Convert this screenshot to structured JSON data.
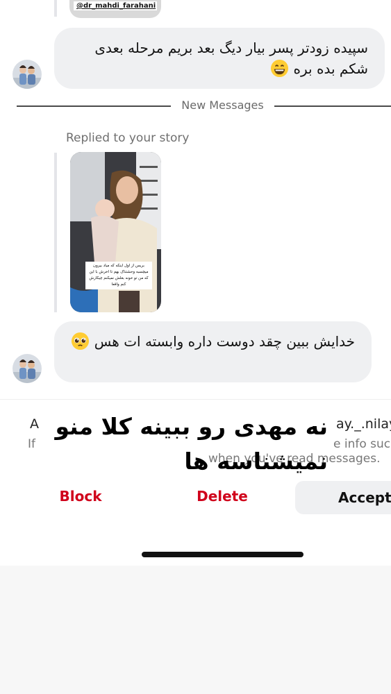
{
  "top_story": {
    "username": "@dr_mahdi_farahani"
  },
  "messages": [
    {
      "text": "سپیده زودتر پسر بیار دیگ بعد بریم مرحله بعدی شکم بده بره",
      "emoji": "grinning-face-emoji"
    },
    {
      "text": "خدایش ببین چقد دوست داره وابسته ات هس",
      "emoji": "pleading-face-emoji"
    }
  ],
  "divider": {
    "label": "New Messages"
  },
  "story_reply": {
    "label": "Replied to your story",
    "caption": "بریس از اول اینکه که میاد بیرون میچسبه وحشتناک بهم تا اخرش با این که من تو خونه بغلش نمیکنم چیکارش کنم واقعا"
  },
  "request_panel": {
    "line1_start": "A",
    "line1_end": "ay._.nilay",
    "line2_start": "If",
    "line2_end": "e info suc",
    "line3": "when you've read messages.",
    "overlay_text": "نه مهدی رو ببینه کلا منو نمیشناسه ها",
    "block_label": "Block",
    "delete_label": "Delete",
    "accept_label": "Accept"
  },
  "colors": {
    "bubble": "#eff0f2",
    "destructive": "#d0021b",
    "muted_text": "#6f6f6f"
  }
}
